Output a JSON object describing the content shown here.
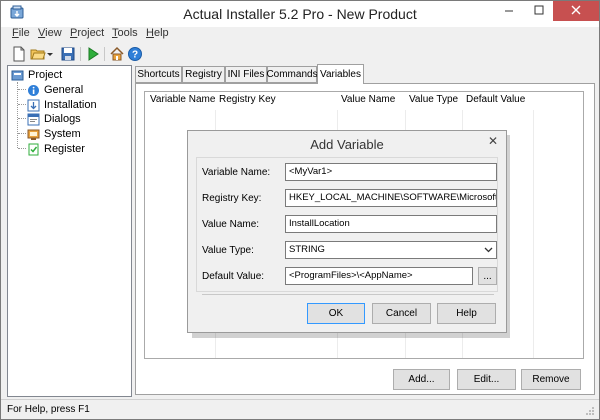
{
  "window": {
    "title": "Actual Installer 5.2 Pro - New Product"
  },
  "menu": [
    {
      "accel": "F",
      "rest": "ile"
    },
    {
      "accel": "V",
      "rest": "iew"
    },
    {
      "accel": "P",
      "rest": "roject"
    },
    {
      "accel": "T",
      "rest": "ools"
    },
    {
      "accel": "H",
      "rest": "elp"
    }
  ],
  "toolbar": {
    "icons": [
      "new-file-icon",
      "open-folder-icon",
      "dropdown-arrow-icon",
      "save-icon",
      "run-icon",
      "home-icon",
      "help-icon"
    ]
  },
  "tree": {
    "root": "Project",
    "items": [
      "General",
      "Installation",
      "Dialogs",
      "System",
      "Register"
    ]
  },
  "tabs": [
    "Shortcuts",
    "Registry",
    "INI Files",
    "Commands",
    "Variables"
  ],
  "active_tab": "Variables",
  "list": {
    "columns": [
      "Variable Name",
      "Registry Key",
      "Value Name",
      "Value Type",
      "Default Value"
    ]
  },
  "buttons": {
    "add": "Add...",
    "edit": "Edit...",
    "remove": "Remove"
  },
  "dialog": {
    "title": "Add Variable",
    "close_glyph": "✕",
    "fields": {
      "variable_name": {
        "label": "Variable Name:",
        "value": "<MyVar1>"
      },
      "registry_key": {
        "label": "Registry Key:",
        "value": "HKEY_LOCAL_MACHINE\\SOFTWARE\\Microsoft\\Windows"
      },
      "value_name": {
        "label": "Value Name:",
        "value": "InstallLocation"
      },
      "value_type": {
        "label": "Value Type:",
        "value": "STRING"
      },
      "default_value": {
        "label": "Default Value:",
        "value": "<ProgramFiles>\\<AppName>"
      }
    },
    "browse_label": "...",
    "ok": "OK",
    "cancel": "Cancel",
    "help": "Help"
  },
  "status": {
    "text": "For Help, press F1"
  }
}
